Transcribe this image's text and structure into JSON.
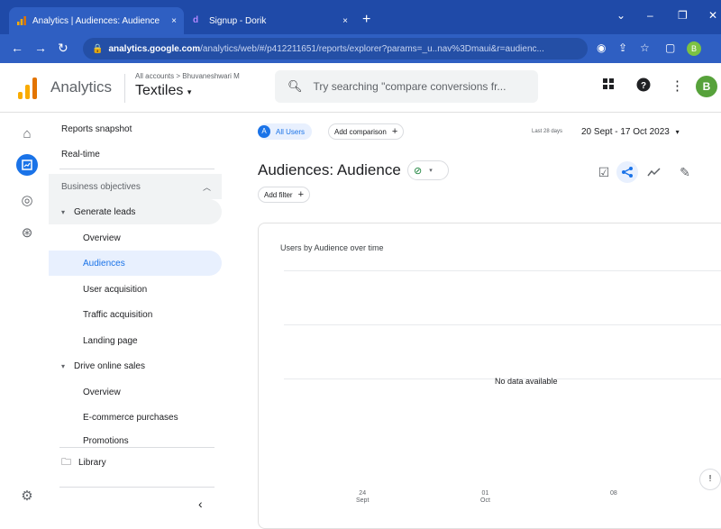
{
  "browser": {
    "tabs": [
      {
        "label": "Analytics | Audiences: Audience",
        "close": "×"
      },
      {
        "label": "Signup - Dorik",
        "close": "×"
      }
    ],
    "new_tab": "+",
    "window_controls": [
      "⌄",
      "–",
      "❐",
      "✕"
    ],
    "url_host": "analytics.google.com",
    "url_path": "/analytics/web/#/p412211651/reports/explorer?params=_u..nav%3Dmaui&r=audienc...",
    "profile_initial": "B"
  },
  "header": {
    "app_name": "Analytics",
    "account_crumb": "All accounts > Bhuvaneshwari M",
    "property": "Textiles",
    "search_placeholder": "Try searching \"compare conversions fr...",
    "avatar_initial": "B"
  },
  "sidebar": {
    "top": [
      {
        "label": "Reports snapshot"
      },
      {
        "label": "Real-time"
      }
    ],
    "section": "Business objectives",
    "groups": [
      {
        "label": "Generate leads",
        "items": [
          "Overview",
          "Audiences",
          "User acquisition",
          "Traffic acquisition",
          "Landing page"
        ]
      },
      {
        "label": "Drive online sales",
        "items": [
          "Overview",
          "E-commerce purchases",
          "Promotions"
        ]
      }
    ],
    "library": "Library"
  },
  "main": {
    "segment_chip": "All Users",
    "segment_initial": "A",
    "compare_chip": "Add comparison",
    "date_label": "Last 28 days",
    "date_range": "20 Sept - 17 Oct 2023",
    "title": "Audiences: Audience",
    "filter_chip": "Add filter",
    "card_title": "Users by Audience over time",
    "no_data": "No data available",
    "x_ticks": [
      {
        "day": "24",
        "month": "Sept"
      },
      {
        "day": "01",
        "month": "Oct"
      },
      {
        "day": "08",
        "month": ""
      }
    ]
  },
  "colors": {
    "brand_orange": "#f9ab00",
    "brand_orange_dark": "#e37400",
    "accent_blue": "#1a73e8",
    "success_green": "#188038"
  }
}
